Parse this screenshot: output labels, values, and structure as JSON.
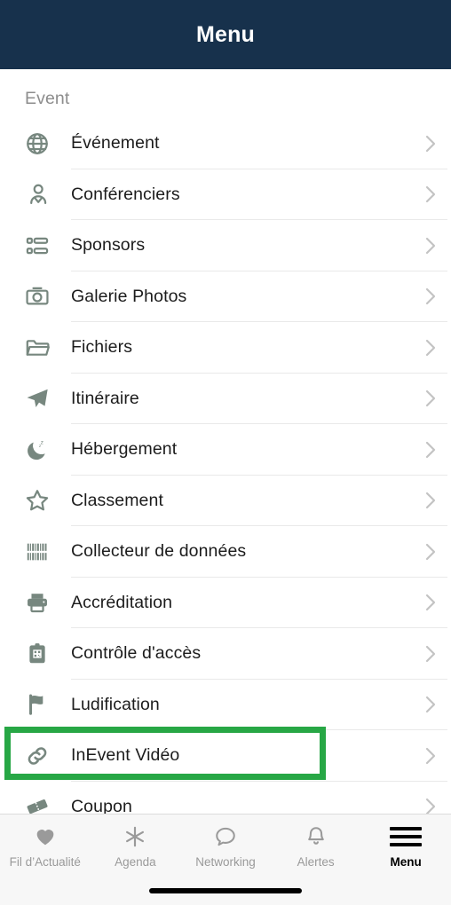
{
  "header": {
    "title": "Menu",
    "background": "#17314c",
    "text_color": "#ffffff"
  },
  "section": {
    "label": "Event"
  },
  "colors": {
    "header_navy": "#17314c",
    "highlight_green": "#27a745",
    "icon_gray": "#77877f",
    "label_text": "#1c1c1c",
    "muted_text": "#8d8d8d",
    "divider": "#e9e9e9",
    "tabbar_background": "#f7f7f7",
    "tab_active": "#000000",
    "tab_inactive": "#9a9a9a"
  },
  "menu": {
    "items": [
      {
        "label": "Événement",
        "icon": "globe-icon",
        "chevron": "›"
      },
      {
        "label": "Conférenciers",
        "icon": "speaker-person-icon",
        "chevron": "›"
      },
      {
        "label": "Sponsors",
        "icon": "sponsors-grid-icon",
        "chevron": "›"
      },
      {
        "label": "Galerie Photos",
        "icon": "camera-icon",
        "chevron": "›"
      },
      {
        "label": "Fichiers",
        "icon": "folder-icon",
        "chevron": "›"
      },
      {
        "label": "Itinéraire",
        "icon": "paper-plane-icon",
        "chevron": "›"
      },
      {
        "label": "Hébergement",
        "icon": "moon-sleep-icon",
        "chevron": "›"
      },
      {
        "label": "Classement",
        "icon": "star-icon",
        "chevron": "›"
      },
      {
        "label": "Collecteur de données",
        "icon": "barcode-icon",
        "chevron": "›"
      },
      {
        "label": "Accréditation",
        "icon": "printer-icon",
        "chevron": "›"
      },
      {
        "label": "Contrôle d'accès",
        "icon": "clipboard-qr-icon",
        "chevron": "›"
      },
      {
        "label": "Ludification",
        "icon": "flag-icon",
        "chevron": "›"
      },
      {
        "label": "InEvent Vidéo",
        "icon": "link-chain-icon",
        "chevron": "›",
        "highlighted": true
      },
      {
        "label": "Coupon",
        "icon": "ticket-icon",
        "chevron": "›"
      }
    ]
  },
  "tabbar": {
    "tabs": [
      {
        "label": "Fil d’Actualité",
        "icon": "heart-icon",
        "active": false
      },
      {
        "label": "Agenda",
        "icon": "asterisk-icon",
        "active": false
      },
      {
        "label": "Networking",
        "icon": "speech-bubble-icon",
        "active": false
      },
      {
        "label": "Alertes",
        "icon": "bell-icon",
        "active": false
      },
      {
        "label": "Menu",
        "icon": "hamburger-icon",
        "active": true
      }
    ]
  }
}
